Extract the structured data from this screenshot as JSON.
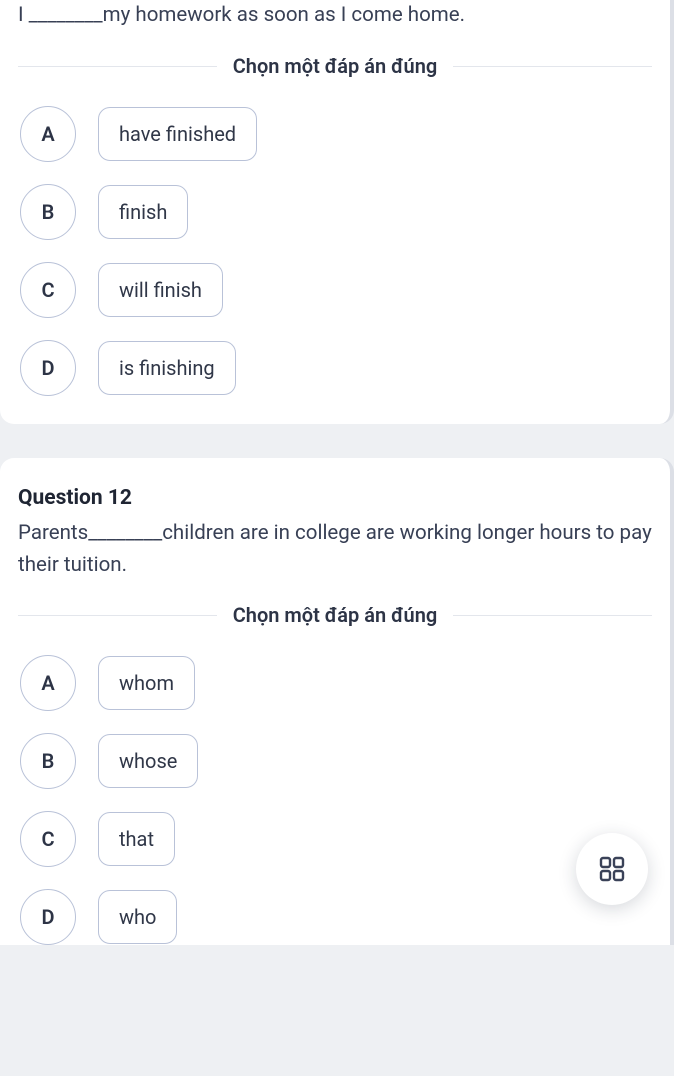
{
  "q11": {
    "text": "I ________my homework as soon as I come home.",
    "prompt": "Chọn một đáp án đúng",
    "options": [
      {
        "letter": "A",
        "text": "have finished"
      },
      {
        "letter": "B",
        "text": "finish"
      },
      {
        "letter": "C",
        "text": "will finish"
      },
      {
        "letter": "D",
        "text": "is finishing"
      }
    ]
  },
  "q12": {
    "title": "Question 12",
    "text": "Parents________children are in college are working longer hours to pay their tuition.",
    "prompt": "Chọn một đáp án đúng",
    "options": [
      {
        "letter": "A",
        "text": "whom"
      },
      {
        "letter": "B",
        "text": "whose"
      },
      {
        "letter": "C",
        "text": "that"
      },
      {
        "letter": "D",
        "text": "who"
      }
    ]
  }
}
